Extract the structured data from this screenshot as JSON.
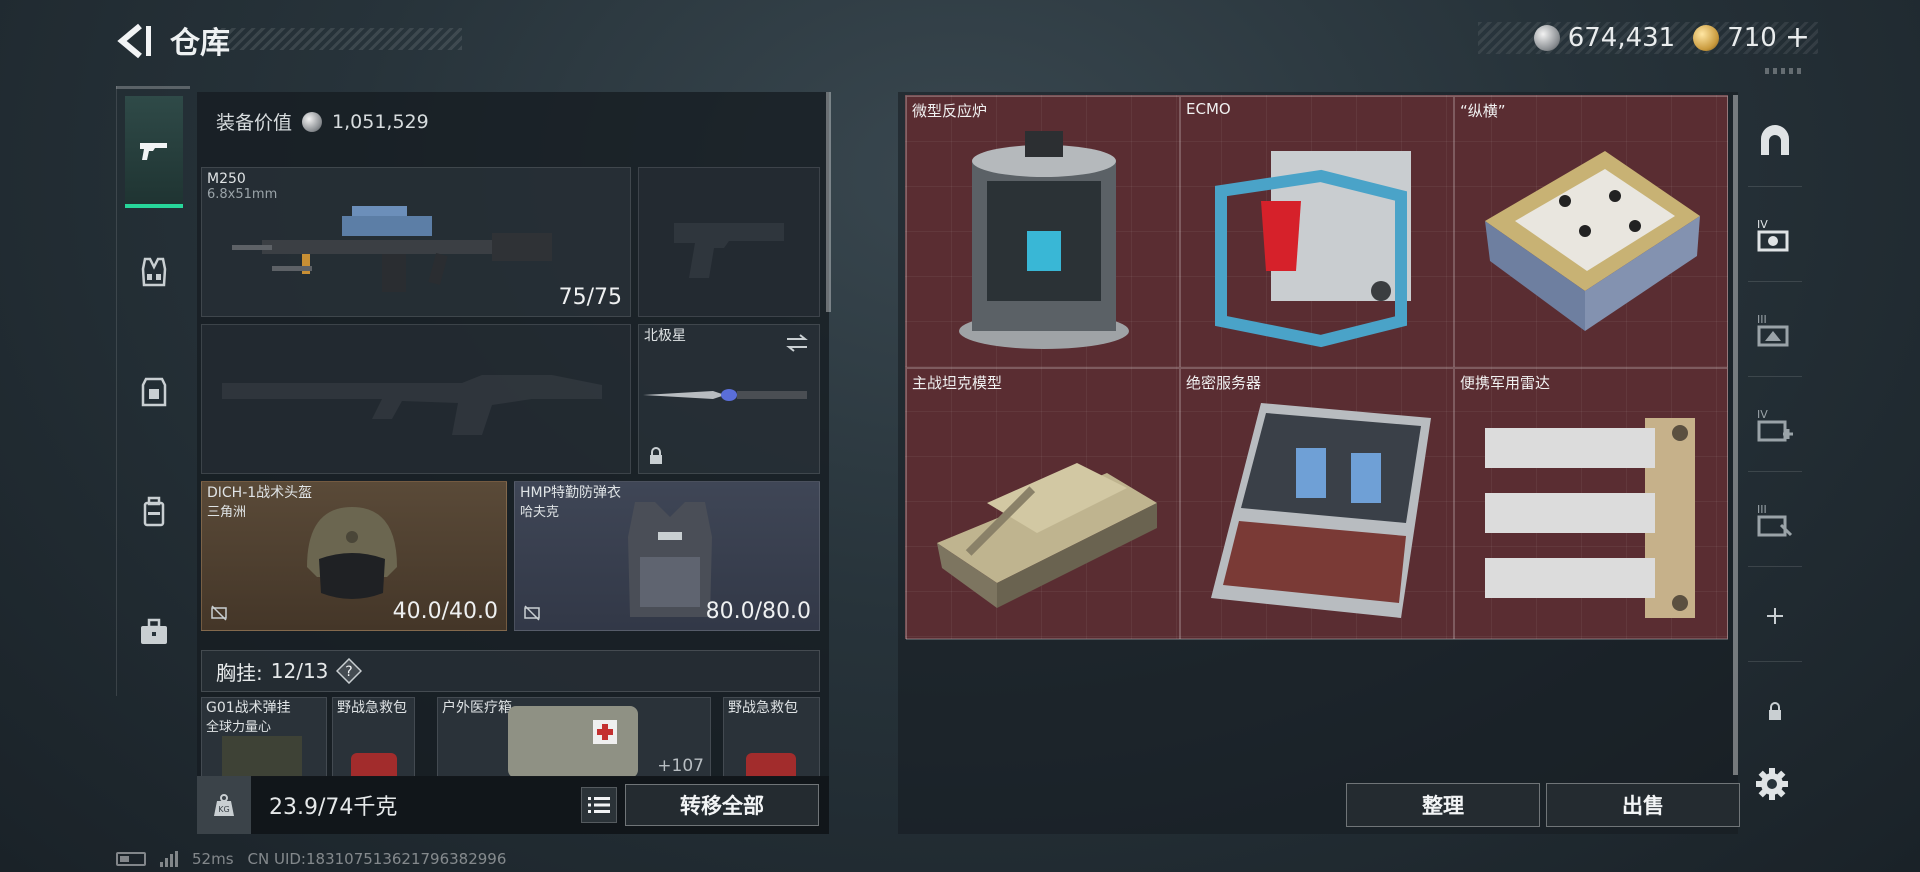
{
  "header": {
    "title": "仓库"
  },
  "currency": {
    "silver_amount": "674,431",
    "gold_amount": "710",
    "add_symbol": "+"
  },
  "loadout": {
    "value_label": "装备价值",
    "value_amount": "1,051,529",
    "primary_weapon": {
      "name": "M250",
      "caliber": "6.8x51mm",
      "ammo": "75/75"
    },
    "melee": {
      "name": "北极星"
    },
    "helmet": {
      "name": "DICH-1战术头盔",
      "brand": "三角洲",
      "durability": "40.0/40.0"
    },
    "armor": {
      "name": "HMP特勤防弹衣",
      "brand": "哈夫克",
      "durability": "80.0/80.0"
    },
    "chest_rig": {
      "label": "胸挂:",
      "capacity": "12/13",
      "help": "?"
    },
    "pockets": [
      {
        "name": "G01战术弹挂",
        "sub": "全球力量心"
      },
      {
        "name": "野战急救包"
      },
      {
        "name": "户外医疗箱",
        "count": "+107"
      },
      {
        "name": "野战急救包"
      }
    ],
    "weight": "23.9/74千克",
    "transfer_all": "转移全部"
  },
  "stash": {
    "items": [
      {
        "name": "微型反应炉"
      },
      {
        "name": "ECMO"
      },
      {
        "name": "“纵横”"
      },
      {
        "name": "主战坦克模型"
      },
      {
        "name": "绝密服务器"
      },
      {
        "name": "便携军用雷达"
      }
    ],
    "sort_button": "整理",
    "sell_button": "出售"
  },
  "right_tabs": [
    {
      "icon": "arch-icon"
    },
    {
      "icon": "tier-iv-tool-icon",
      "roman": "IV"
    },
    {
      "icon": "tier-iii-tool-icon",
      "roman": "III"
    },
    {
      "icon": "tier-iv-medkit-icon",
      "roman": "IV"
    },
    {
      "icon": "tier-iii-tool-icon",
      "roman": "III"
    },
    {
      "icon": "plus-icon"
    },
    {
      "icon": "lock-icon"
    }
  ],
  "status_bar": {
    "ping": "52ms",
    "uid": "CN UID:18310751362179638299​6"
  },
  "colors": {
    "accent": "#27d69a",
    "stash_bg": "#5a2d32"
  }
}
